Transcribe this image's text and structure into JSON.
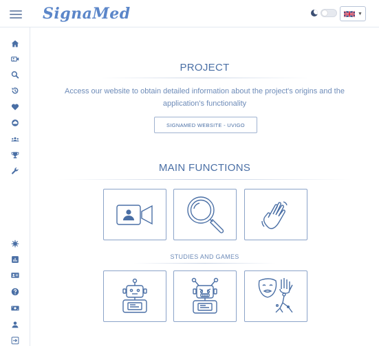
{
  "header": {
    "app_name": "SignaMed",
    "menu_icon": "hamburger-icon",
    "theme_icon": "moon-icon",
    "language_flag": "uk-flag-icon"
  },
  "sidebar": {
    "top_items": [
      {
        "icon": "home-icon"
      },
      {
        "icon": "video-icon"
      },
      {
        "icon": "search-icon"
      },
      {
        "icon": "history-icon"
      },
      {
        "icon": "heart-icon"
      },
      {
        "icon": "cloud-icon"
      },
      {
        "icon": "users-icon"
      },
      {
        "icon": "trophy-icon"
      },
      {
        "icon": "wrench-icon"
      }
    ],
    "bottom_items": [
      {
        "icon": "virus-icon"
      },
      {
        "icon": "chart-icon"
      },
      {
        "icon": "id-card-icon"
      },
      {
        "icon": "help-icon"
      },
      {
        "icon": "money-icon"
      },
      {
        "icon": "user-icon"
      },
      {
        "icon": "logout-icon"
      }
    ]
  },
  "project": {
    "title": "PROJECT",
    "description": "Access our website to obtain detailed information about the project's origins and the application's functionality",
    "website_button": "SIGNAMED WEBSITE - UVIGO"
  },
  "main_functions": {
    "title": "MAIN FUNCTIONS",
    "cards": [
      {
        "icon": "video-camera-person-icon"
      },
      {
        "icon": "magnifier-icon"
      },
      {
        "icon": "waving-hand-icon"
      }
    ]
  },
  "studies": {
    "title": "STUDIES AND GAMES",
    "cards": [
      {
        "icon": "robot-icon"
      },
      {
        "icon": "angry-robot-icon"
      },
      {
        "icon": "masks-icon"
      }
    ]
  },
  "colors": {
    "accent": "#4a6fa5",
    "logo": "#5b86c9",
    "border": "#8aa2c8"
  }
}
